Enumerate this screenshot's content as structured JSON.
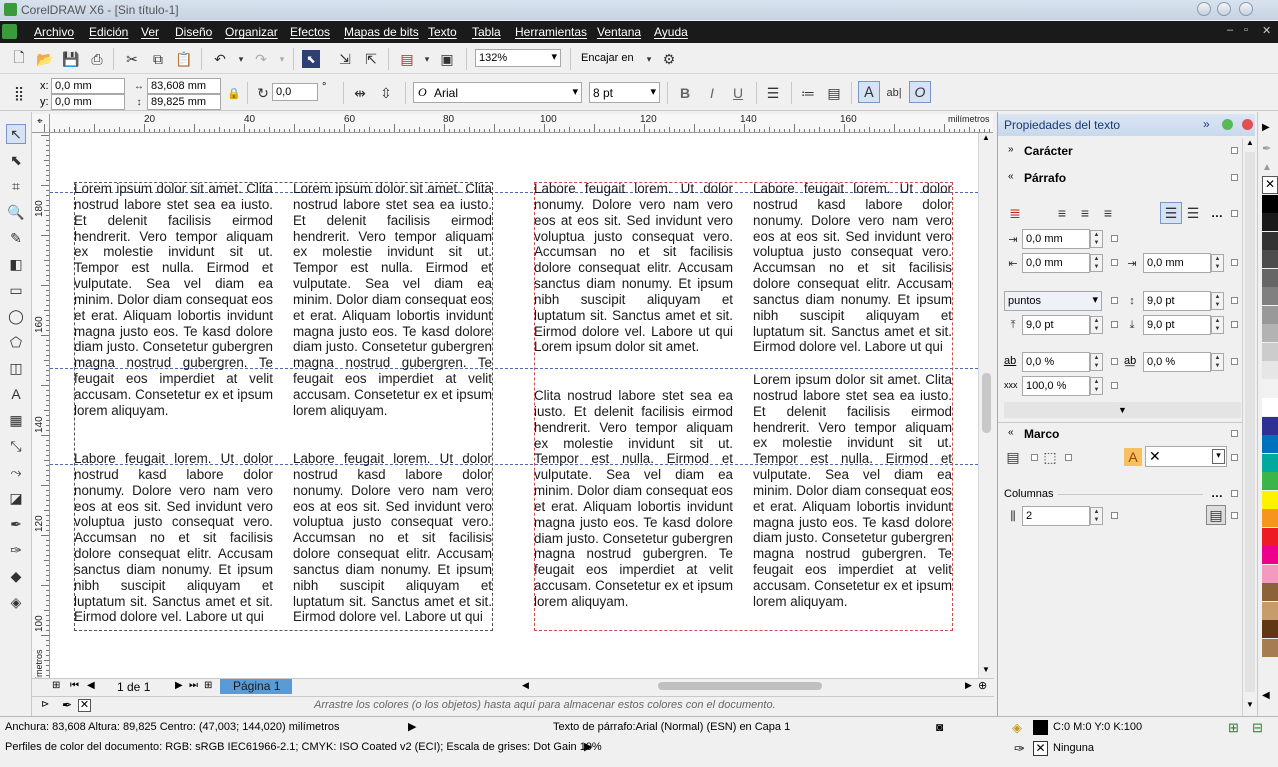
{
  "window": {
    "title": "CorelDRAW X6 - [Sin título-1]"
  },
  "menu": [
    "Archivo",
    "Edición",
    "Ver",
    "Diseño",
    "Organizar",
    "Efectos",
    "Mapas de bits",
    "Texto",
    "Tabla",
    "Herramientas",
    "Ventana",
    "Ayuda"
  ],
  "toolbar": {
    "zoom": "132%",
    "snap": "Encajar en"
  },
  "propbar": {
    "x": "0,0 mm",
    "y": "0,0 mm",
    "width": "83,608 mm",
    "height": "89,825 mm",
    "rotation": "0,0",
    "rotation_unit": "°",
    "font": "Arial",
    "font_size": "8 pt"
  },
  "rulers": {
    "unit": "milímetros",
    "h_ticks": [
      "20",
      "40",
      "60",
      "80",
      "100",
      "120",
      "140",
      "160"
    ],
    "v_ticks": [
      "180",
      "160",
      "140",
      "120",
      "100"
    ]
  },
  "document": {
    "columns": [
      {
        "top": "Lorem ipsum dolor sit amet. Clita nostrud labore stet sea ea iusto. Et delenit facilisis eirmod hendrerit. Vero tempor aliquam ex molestie invidunt sit ut. Tempor est nulla. Eirmod et vulputate. Sea vel diam ea minim. Dolor diam consequat eos et erat. Aliquam lobortis invidunt magna justo eos. Te kasd dolore diam justo. Consetetur gubergren magna nostrud gubergren. Te feugait eos imperdiet at velit accusam. Consetetur ex et ipsum lorem aliquyam.",
        "bottom": "Labore feugait lorem. Ut dolor nostrud kasd labore dolor nonumy. Dolore vero nam vero eos at eos sit. Sed invidunt vero voluptua justo consequat vero. Accumsan no et sit facilisis dolore consequat elitr. Accusam sanctus diam nonumy. Et ipsum nibh suscipit aliquyam et luptatum sit. Sanctus amet et sit. Eirmod dolore vel. Labore ut qui"
      },
      {
        "top": "Lorem ipsum dolor sit amet. Clita nostrud labore stet sea ea iusto. Et delenit facilisis eirmod hendrerit. Vero tempor aliquam ex molestie invidunt sit ut. Tempor est nulla. Eirmod et vulputate. Sea vel diam ea minim. Dolor diam consequat eos et erat. Aliquam lobortis invidunt magna justo eos. Te kasd dolore diam justo. Consetetur gubergren magna nostrud gubergren. Te feugait eos imperdiet at velit accusam. Consetetur ex et ipsum lorem aliquyam.",
        "bottom": "Labore feugait lorem. Ut dolor nostrud kasd labore dolor nonumy. Dolore vero nam vero eos at eos sit. Sed invidunt vero voluptua justo consequat vero. Accumsan no et sit facilisis dolore consequat elitr. Accusam sanctus diam nonumy. Et ipsum nibh suscipit aliquyam et luptatum sit. Sanctus amet et sit. Eirmod dolore vel. Labore ut qui"
      },
      {
        "top": "Labore feugait lorem. Ut dolor nonumy. Dolore vero nam vero eos at eos sit. Sed invidunt vero voluptua justo consequat vero. Accumsan no et sit facilisis dolore consequat elitr. Accusam sanctus diam nonumy. Et ipsum nibh suscipit aliquyam et luptatum sit. Sanctus amet et sit. Eirmod dolore vel. Labore ut qui Lorem ipsum dolor sit amet.",
        "bottom": "Clita nostrud labore stet sea ea iusto. Et delenit facilisis eirmod hendrerit. Vero tempor aliquam ex molestie invidunt sit ut. Tempor est nulla. Eirmod et vulputate. Sea vel diam ea minim. Dolor diam consequat eos et erat. Aliquam lobortis invidunt magna justo eos. Te kasd dolore diam justo. Consetetur gubergren magna nostrud gubergren. Te feugait eos imperdiet at velit accusam. Consetetur ex et ipsum lorem aliquyam."
      },
      {
        "top": "Labore feugait lorem. Ut dolor nostrud kasd labore dolor nonumy. Dolore vero nam vero eos at eos sit. Sed invidunt vero voluptua justo consequat vero. Accumsan no et sit facilisis dolore consequat elitr. Accusam sanctus diam nonumy. Et ipsum nibh suscipit aliquyam et luptatum sit. Sanctus amet et sit. Eirmod dolore vel. Labore ut qui",
        "bottom": "Lorem ipsum dolor sit amet. Clita nostrud labore stet sea ea iusto. Et delenit facilisis eirmod hendrerit. Vero tempor aliquam ex molestie invidunt sit ut. Tempor est nulla. Eirmod et vulputate. Sea vel diam ea minim. Dolor diam consequat eos et erat. Aliquam lobortis invidunt magna justo eos. Te kasd dolore diam justo. Consetetur gubergren magna nostrud gubergren. Te feugait eos imperdiet at velit accusam. Consetetur ex et ipsum lorem aliquyam."
      }
    ]
  },
  "pages": {
    "counter": "1 de 1",
    "tab": "Página 1"
  },
  "palette_hint": "Arrastre los colores (o los objetos) hasta aquí para almacenar estos colores con el documento.",
  "panel": {
    "title": "Propiedades del texto",
    "sections": {
      "character": "Carácter",
      "paragraph": "Párrafo",
      "frame": "Marco"
    },
    "indent_first": "0,0 mm",
    "indent_left": "0,0 mm",
    "indent_right": "0,0 mm",
    "spacing_unit": "puntos",
    "line_spacing": "9,0 pt",
    "space_before": "9,0 pt",
    "space_after": "9,0 pt",
    "char_spacing": "0,0 %",
    "word_spacing": "0,0 %",
    "lang_spacing": "100,0 %",
    "columns_label": "Columnas",
    "columns_value": "2"
  },
  "status": {
    "dims": "Anchura: 83,608  Altura: 89,825  Centro: (47,003; 144,020)  milímetros",
    "object": "Texto de párrafo:Arial (Normal) (ESN) en Capa 1",
    "fill": "C:0 M:0 Y:0 K:100",
    "outline": "Ninguna",
    "profiles": "Perfiles de color del documento: RGB: sRGB IEC61966-2.1; CMYK: ISO Coated v2 (ECI); Escala de grises: Dot Gain 10%"
  },
  "colors": {
    "palette": [
      "#ffffff",
      "#000000",
      "#1a1a1a",
      "#333333",
      "#4d4d4d",
      "#666666",
      "#808080",
      "#999999",
      "#b3b3b3",
      "#cccccc",
      "#e6e6e6",
      "#f2f2f2",
      "#ffffff",
      "#2e3192",
      "#0071bc",
      "#00a99d",
      "#39b54a",
      "#fff200",
      "#f7941d",
      "#ed1c24",
      "#ec008c",
      "#f49ac1",
      "#8c6239",
      "#c69c6d",
      "#603813",
      "#a67c52"
    ]
  }
}
